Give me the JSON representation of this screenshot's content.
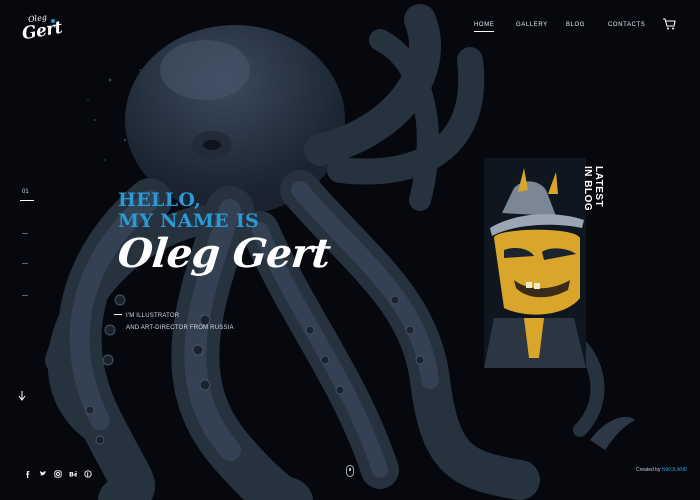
{
  "logo": {
    "top": "Oleg",
    "main": "Gert"
  },
  "nav": {
    "items": [
      {
        "label": "HOME",
        "active": true
      },
      {
        "label": "GALLERY",
        "active": false
      },
      {
        "label": "BLOG",
        "active": false
      },
      {
        "label": "CONTACTS",
        "active": false
      }
    ],
    "cart_icon": "cart-icon"
  },
  "slider": {
    "current": "01",
    "arrow_icon": "arrow-down-icon"
  },
  "hero": {
    "greeting": "HELLO,\nMY NAME IS",
    "name": "Oleg Gert",
    "role_line1": "I'M ILLUSTRATOR",
    "role_line2": "AND ART-DIRECTOR FROM RUSSIA"
  },
  "blog": {
    "label": "LATEST\nIN BLOG"
  },
  "social": [
    "facebook-icon",
    "twitter-icon",
    "instagram-icon",
    "behance-icon",
    "pinterest-icon"
  ],
  "footer": {
    "credit_prefix": "Created by",
    "credit_name": "NIKOLAND"
  },
  "colors": {
    "accent": "#2a9ad6",
    "background": "#06080d",
    "octopus": "#2a3645",
    "llama": "#d9a62b"
  }
}
